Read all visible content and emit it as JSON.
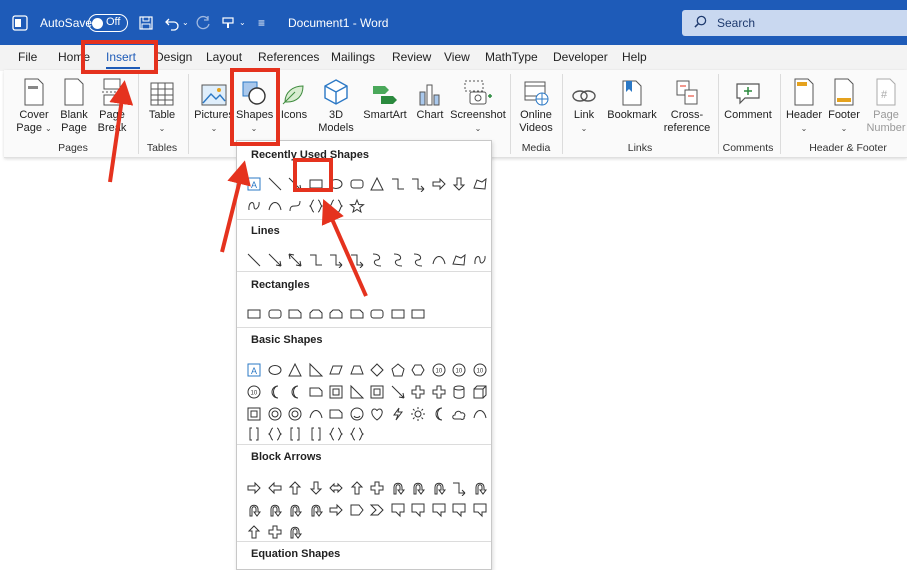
{
  "titlebar": {
    "autosave_label": "AutoSave",
    "autosave_state": "Off",
    "doc_title": "Document1  -  Word",
    "search_placeholder": "Search"
  },
  "tabs": [
    "File",
    "Home",
    "Insert",
    "Design",
    "Layout",
    "References",
    "Mailings",
    "Review",
    "View",
    "MathType",
    "Developer",
    "Help"
  ],
  "ribbon": {
    "pages": {
      "cover_page": "Cover",
      "cover_page_2": "Page",
      "blank_page": "Blank",
      "blank_page_2": "Page",
      "page_break": "Page",
      "page_break_2": "Break",
      "group": "Pages"
    },
    "tables": {
      "table": "Table",
      "group": "Tables"
    },
    "illustrations": {
      "pictures": "Pictures",
      "shapes": "Shapes",
      "icons": "Icons",
      "models": "3D",
      "models_2": "Models",
      "smartart": "SmartArt",
      "chart": "Chart",
      "screenshot": "Screenshot"
    },
    "media": {
      "online_videos": "Online",
      "online_videos_2": "Videos",
      "group": "Media"
    },
    "links": {
      "link": "Link",
      "bookmark": "Bookmark",
      "cross_ref": "Cross-",
      "cross_ref_2": "reference",
      "group": "Links"
    },
    "comments": {
      "comment": "Comment",
      "group": "Comments"
    },
    "header_footer": {
      "header": "Header",
      "footer": "Footer",
      "page_number": "Page",
      "page_number_2": "Number",
      "group": "Header & Footer"
    }
  },
  "shapes_panel": {
    "sections": [
      "Recently Used Shapes",
      "Lines",
      "Rectangles",
      "Basic Shapes",
      "Block Arrows",
      "Equation Shapes"
    ]
  },
  "colors": {
    "titlebar": "#1e5bb8",
    "highlight": "#e5321e",
    "tab_accent": "#1e5bb8"
  }
}
